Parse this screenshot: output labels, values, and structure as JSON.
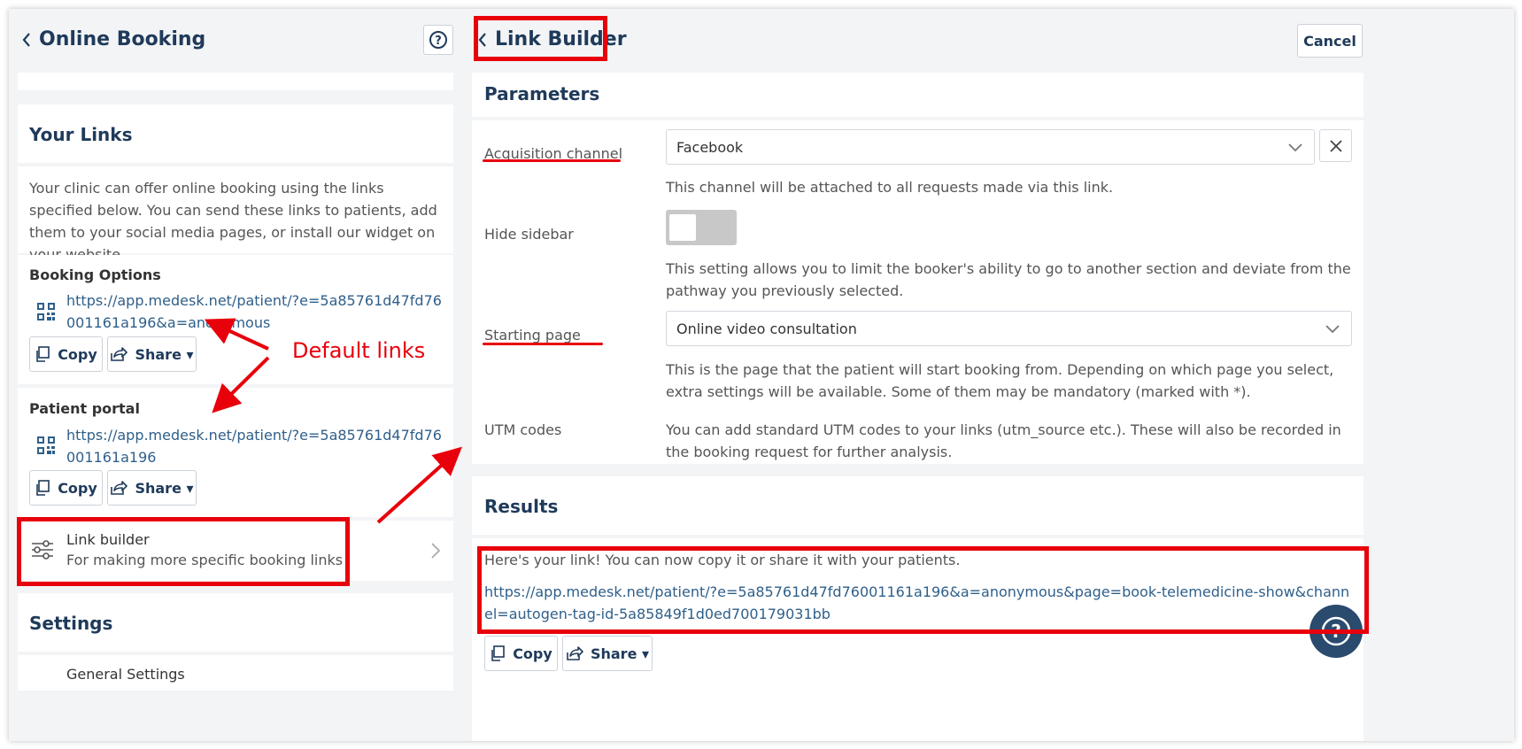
{
  "left_header": {
    "title": "Online Booking"
  },
  "your_links": {
    "title": "Your Links",
    "description": "Your clinic can offer online booking using the links specified below. You can send these links to patients, add them to your social media pages, or install our widget on your website.",
    "booking_options": {
      "title": "Booking Options",
      "url": "https://app.medesk.net/patient/?e=5a85761d47fd76001161a196&a=anonymous",
      "copy_label": "Copy",
      "share_label": "Share ▾"
    },
    "patient_portal": {
      "title": "Patient portal",
      "url": "https://app.medesk.net/patient/?e=5a85761d47fd76001161a196",
      "copy_label": "Copy",
      "share_label": "Share ▾"
    },
    "link_builder": {
      "title": "Link builder",
      "subtitle": "For making more specific booking links"
    }
  },
  "settings": {
    "title": "Settings",
    "general_label": "General Settings"
  },
  "annotation": {
    "default_links": "Default links"
  },
  "right_header": {
    "title": "Link Builder",
    "cancel_label": "Cancel"
  },
  "parameters": {
    "title": "Parameters",
    "acquisition": {
      "label": "Acquisition channel",
      "value": "Facebook",
      "help": "This channel will be attached to all requests made via this link."
    },
    "hide_sidebar": {
      "label": "Hide sidebar",
      "enabled": false,
      "help": "This setting allows you to limit the booker's ability to go to another section and deviate from the pathway you previously selected."
    },
    "starting_page": {
      "label": "Starting page",
      "value": "Online video consultation",
      "help": "This is the page that the patient will start booking from. Depending on which page you select, extra settings will be available. Some of them may be mandatory (marked with *)."
    },
    "utm": {
      "label": "UTM codes",
      "help": "You can add standard UTM codes to your links (utm_source etc.). These will also be recorded in the booking request for further analysis."
    }
  },
  "results": {
    "title": "Results",
    "message": "Here's your link! You can now copy it or share it with your patients.",
    "url": "https://app.medesk.net/patient/?e=5a85761d47fd76001161a196&a=anonymous&page=book-telemedicine-show&channel=autogen-tag-id-5a85849f1d0ed700179031bb",
    "copy_label": "Copy",
    "share_label": "Share ▾"
  },
  "colors": {
    "brand_navy": "#1f3a5a",
    "link_blue": "#2f5f8a",
    "annotation_red": "#e8000b",
    "help_fab": "#2a4a6e"
  }
}
